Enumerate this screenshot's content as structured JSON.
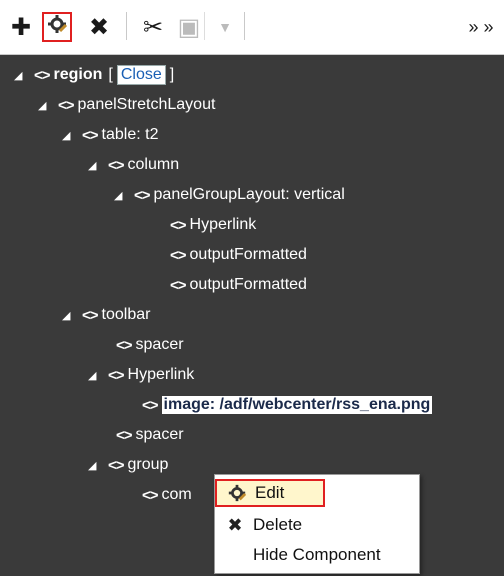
{
  "toolbar": {
    "buttons": [
      {
        "icon": "plus-icon"
      },
      {
        "icon": "edit-component-icon"
      },
      {
        "icon": "delete-x-icon"
      },
      {
        "icon": "cut-icon"
      },
      {
        "icon": "copy-icon"
      },
      {
        "icon": "dropdown-icon"
      },
      {
        "icon": "expand-more-icon"
      }
    ]
  },
  "tree": {
    "region": {
      "label": "region",
      "bracket_open": "[",
      "close_label": "Close",
      "bracket_close": "]"
    },
    "panelStretchLayout": "panelStretchLayout",
    "table": "table: t2",
    "column": "column",
    "panelGroupLayout": "panelGroupLayout: vertical",
    "hyperlink1": "Hyperlink",
    "outputFormatted1": "outputFormatted",
    "outputFormatted2": "outputFormatted",
    "toolbar": "toolbar",
    "spacer1": "spacer",
    "hyperlink2": "Hyperlink",
    "image": "image: /adf/webcenter/rss_ena.png",
    "spacer2": "spacer",
    "group": "group",
    "com": "com"
  },
  "context_menu": {
    "edit": "Edit",
    "delete": "Delete",
    "hide": "Hide Component"
  }
}
